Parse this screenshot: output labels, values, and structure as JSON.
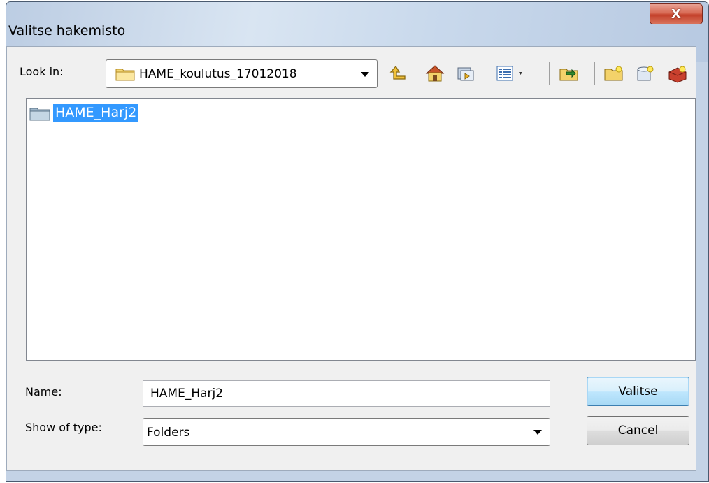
{
  "window": {
    "title": "Valitse hakemisto",
    "close_glyph": "X"
  },
  "lookin": {
    "label": "Look in:",
    "value": "HAME_koulutus_17012018"
  },
  "toolbar": {
    "icons": [
      "up-one-level-icon",
      "home-folder-icon",
      "catalog-icon",
      "view-menu-icon",
      "connect-folder-icon",
      "new-folder-icon",
      "new-database-icon",
      "toolbox-icon"
    ]
  },
  "list": {
    "items": [
      {
        "label": "HAME_Harj2",
        "selected": true
      }
    ]
  },
  "name_field": {
    "label": "Name:",
    "value": "HAME_Harj2"
  },
  "type_field": {
    "label": "Show of type:",
    "value": "Folders"
  },
  "buttons": {
    "ok": "Valitse",
    "cancel": "Cancel"
  },
  "colors": {
    "selection": "#3399ff",
    "close_button": "#c9503a"
  }
}
